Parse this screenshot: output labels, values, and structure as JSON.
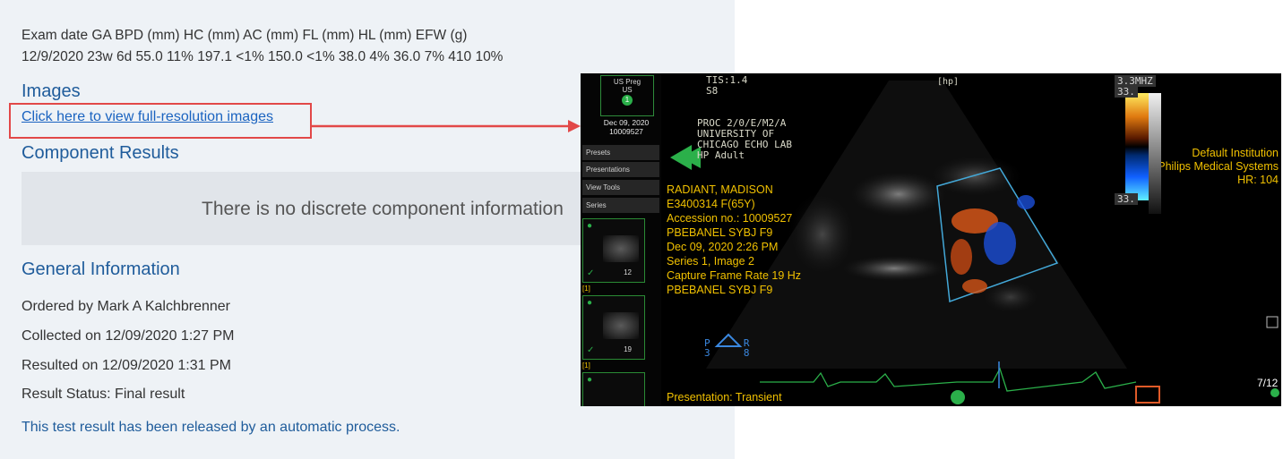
{
  "report": {
    "measure_header": "Exam date GA BPD (mm) HC (mm) AC (mm) FL (mm) HL (mm) EFW (g)",
    "measure_values": "12/9/2020 23w 6d 55.0 11% 197.1 <1% 150.0 <1% 38.0 4% 36.0 7% 410 10%",
    "images_heading": "Images",
    "images_link": "Click here to view full-resolution images",
    "component_heading": "Component Results",
    "component_empty": "There is no discrete component information",
    "general_heading": "General Information",
    "ordered_by": "Ordered by Mark A Kalchbrenner",
    "collected": "Collected on 12/09/2020 1:27 PM",
    "resulted": "Resulted on 12/09/2020 1:31 PM",
    "status": "Result Status: Final result",
    "released": "This test result has been released by an automatic process."
  },
  "colors": {
    "heading": "#1f5c9b",
    "link": "#1a63c0",
    "annotation": "#e24848",
    "overlay_text": "#f0c000",
    "thumb_border": "#2a8b35"
  },
  "viewer": {
    "study_tile": {
      "line1": "US Preg",
      "line2": "US",
      "badge": "1"
    },
    "study_date": "Dec 09, 2020",
    "study_number": "10009527",
    "menu": [
      "Presets",
      "Presentations",
      "View Tools",
      "Series"
    ],
    "thumbs": [
      {
        "count": "12",
        "tag": "[1]"
      },
      {
        "count": "19",
        "tag": "[1]"
      },
      {
        "count": "",
        "tag": ""
      }
    ],
    "tis": "TIS:1.4",
    "s8": "S8",
    "proc": "PROC 2/0/E/M2/A",
    "university": "UNIVERSITY OF",
    "lab": "CHICAGO ECHO LAB",
    "preset": "HP Adult",
    "hp_tag": "[hp]",
    "patient_lines": [
      "RADIANT, MADISON",
      "E3400314 F(65Y)",
      "Accession no.: 10009527",
      "PBEBANEL SYBJ F9",
      "Dec 09, 2020 2:26 PM",
      "Series 1, Image 2",
      "Capture Frame Rate 19 Hz",
      "PBEBANEL SYBJ F9"
    ],
    "institution_lines": [
      "Default Institution",
      "Philips Medical Systems",
      "HR: 104"
    ],
    "mhz": "3.3MHZ",
    "scale_top": "33.",
    "scale_bottom": "33.",
    "presentation": "Presentation: Transient",
    "frame_count": "7/12",
    "probe_labels": {
      "p": "P",
      "r": "R",
      "n1": "3",
      "n2": "8"
    }
  }
}
